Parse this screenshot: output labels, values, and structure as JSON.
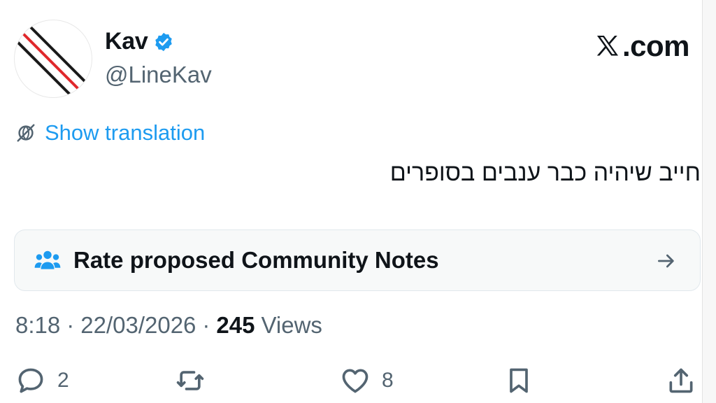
{
  "author": {
    "name": "Kav",
    "handle": "@LineKav",
    "verified": true
  },
  "site": {
    "logo_text": ".com"
  },
  "translation": {
    "label": "Show translation"
  },
  "tweet": {
    "text": "חייב שיהיה כבר ענבים בסופרים"
  },
  "community_notes": {
    "label": "Rate proposed Community Notes"
  },
  "meta": {
    "time": "8:18",
    "separator": "·",
    "date": "22/03/2026",
    "views_count": "245",
    "views_label": "Views"
  },
  "actions": {
    "replies": "2",
    "likes": "8"
  },
  "colors": {
    "link_blue": "#1d9bf0",
    "secondary_gray": "#536471",
    "avatar_stripe_red": "#e0282c"
  },
  "icons": {
    "verified": "verified-badge-icon",
    "translate": "globe-slash-icon",
    "notes": "people-icon",
    "arrow": "arrow-right-icon",
    "reply": "speech-bubble-icon",
    "retweet": "retweet-icon",
    "like": "heart-icon",
    "bookmark": "bookmark-icon",
    "share": "share-icon"
  }
}
